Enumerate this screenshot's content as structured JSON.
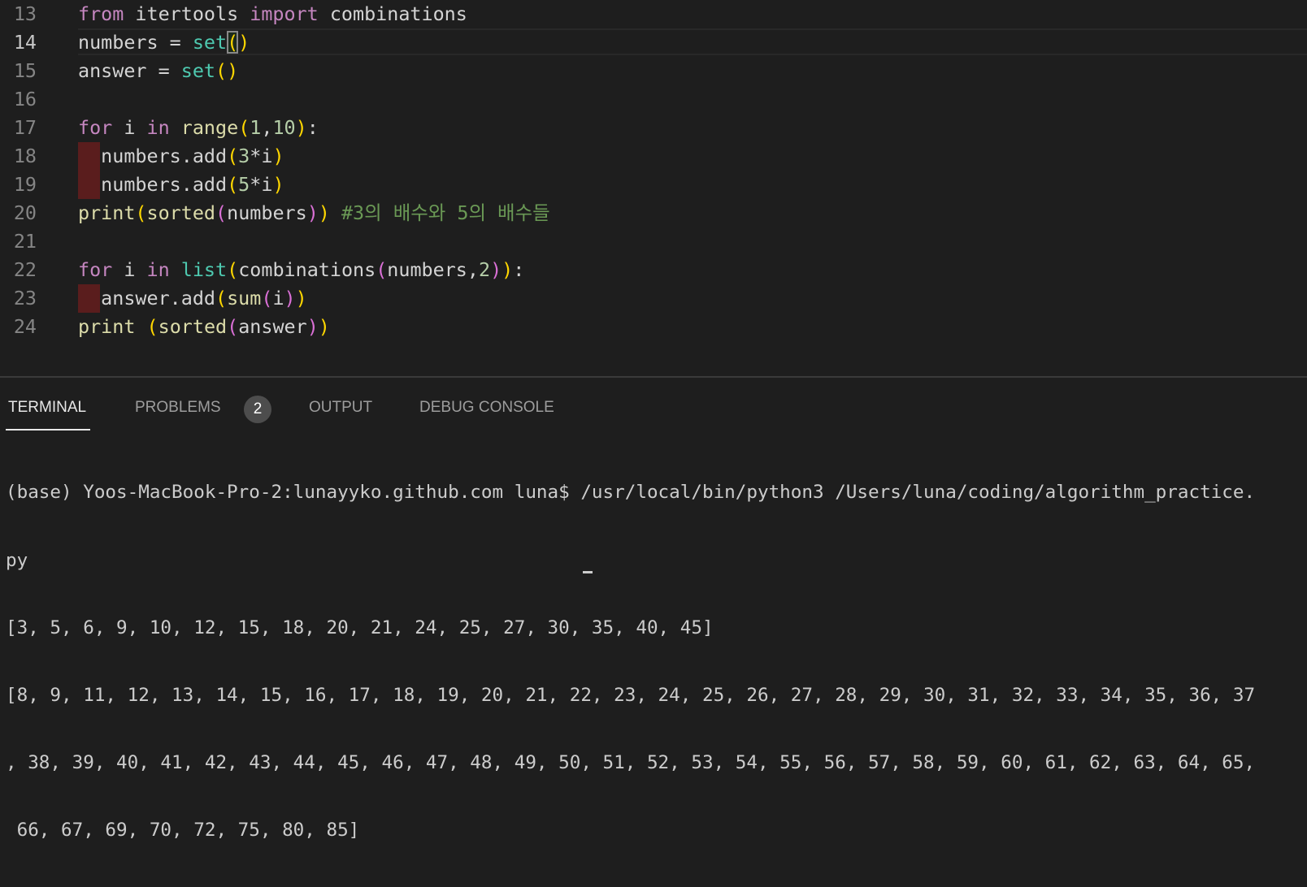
{
  "editor": {
    "active_line": 14,
    "lines": [
      {
        "n": "13",
        "tokens": [
          [
            "from",
            "kw"
          ],
          [
            " itertools ",
            "tx"
          ],
          [
            "import",
            "kw"
          ],
          [
            " combinations",
            "tx"
          ]
        ]
      },
      {
        "n": "14",
        "tokens": [
          [
            "numbers = ",
            "tx"
          ],
          [
            "set",
            "bi"
          ],
          [
            "(",
            "p1 bracket-match"
          ],
          [
            ")",
            "p1"
          ]
        ]
      },
      {
        "n": "15",
        "tokens": [
          [
            "answer = ",
            "tx"
          ],
          [
            "set",
            "bi"
          ],
          [
            "(",
            "p1"
          ],
          [
            ")",
            "p1"
          ]
        ]
      },
      {
        "n": "16",
        "tokens": []
      },
      {
        "n": "17",
        "tokens": [
          [
            "for",
            "kw"
          ],
          [
            " i ",
            "tx"
          ],
          [
            "in",
            "kw"
          ],
          [
            " ",
            "tx"
          ],
          [
            "range",
            "fn"
          ],
          [
            "(",
            "p1"
          ],
          [
            "1",
            "num"
          ],
          [
            ",",
            "tx"
          ],
          [
            "10",
            "num"
          ],
          [
            ")",
            "p1"
          ],
          [
            ":",
            "tx"
          ]
        ]
      },
      {
        "n": "18",
        "indent_error": true,
        "tokens": [
          [
            "  numbers.add",
            "tx"
          ],
          [
            "(",
            "p1"
          ],
          [
            "3",
            "num"
          ],
          [
            "*i",
            "tx"
          ],
          [
            ")",
            "p1"
          ]
        ]
      },
      {
        "n": "19",
        "indent_error": true,
        "tokens": [
          [
            "  numbers.add",
            "tx"
          ],
          [
            "(",
            "p1"
          ],
          [
            "5",
            "num"
          ],
          [
            "*i",
            "tx"
          ],
          [
            ")",
            "p1"
          ]
        ]
      },
      {
        "n": "20",
        "tokens": [
          [
            "print",
            "fn"
          ],
          [
            "(",
            "p1"
          ],
          [
            "sorted",
            "fn"
          ],
          [
            "(",
            "p2"
          ],
          [
            "numbers",
            "tx"
          ],
          [
            ")",
            "p2"
          ],
          [
            ")",
            "p1"
          ],
          [
            " ",
            "tx"
          ],
          [
            "#3의 배수와 5의 배수들",
            "cm"
          ]
        ]
      },
      {
        "n": "21",
        "tokens": []
      },
      {
        "n": "22",
        "tokens": [
          [
            "for",
            "kw"
          ],
          [
            " i ",
            "tx"
          ],
          [
            "in",
            "kw"
          ],
          [
            " ",
            "tx"
          ],
          [
            "list",
            "bi"
          ],
          [
            "(",
            "p1"
          ],
          [
            "combinations",
            "tx"
          ],
          [
            "(",
            "p2"
          ],
          [
            "numbers,",
            "tx"
          ],
          [
            "2",
            "num"
          ],
          [
            ")",
            "p2"
          ],
          [
            ")",
            "p1"
          ],
          [
            ":",
            "tx"
          ]
        ]
      },
      {
        "n": "23",
        "indent_error": true,
        "tokens": [
          [
            "  answer.add",
            "tx"
          ],
          [
            "(",
            "p1"
          ],
          [
            "sum",
            "fn"
          ],
          [
            "(",
            "p2"
          ],
          [
            "i",
            "tx"
          ],
          [
            ")",
            "p2"
          ],
          [
            ")",
            "p1"
          ]
        ]
      },
      {
        "n": "24",
        "tokens": [
          [
            "print",
            "fn"
          ],
          [
            " ",
            "tx"
          ],
          [
            "(",
            "p1"
          ],
          [
            "sorted",
            "fn"
          ],
          [
            "(",
            "p2"
          ],
          [
            "answer",
            "tx"
          ],
          [
            ")",
            "p2"
          ],
          [
            ")",
            "p1"
          ]
        ]
      }
    ]
  },
  "panel": {
    "tabs": [
      {
        "label": "TERMINAL",
        "active": true
      },
      {
        "label": "PROBLEMS",
        "badge": "2"
      },
      {
        "label": "OUTPUT"
      },
      {
        "label": "DEBUG CONSOLE"
      }
    ],
    "terminal_lines": [
      "(base) Yoos-MacBook-Pro-2:lunayyko.github.com luna$ /usr/local/bin/python3 /Users/luna/coding/algorithm_practice.",
      "py",
      "[3, 5, 6, 9, 10, 12, 15, 18, 20, 21, 24, 25, 27, 30, 35, 40, 45]",
      "[8, 9, 11, 12, 13, 14, 15, 16, 17, 18, 19, 20, 21, 22, 23, 24, 25, 26, 27, 28, 29, 30, 31, 32, 33, 34, 35, 36, 37",
      ", 38, 39, 40, 41, 42, 43, 44, 45, 46, 47, 48, 49, 50, 51, 52, 53, 54, 55, 56, 57, 58, 59, 60, 61, 62, 63, 64, 65,",
      " 66, 67, 69, 70, 72, 75, 80, 85]"
    ]
  }
}
